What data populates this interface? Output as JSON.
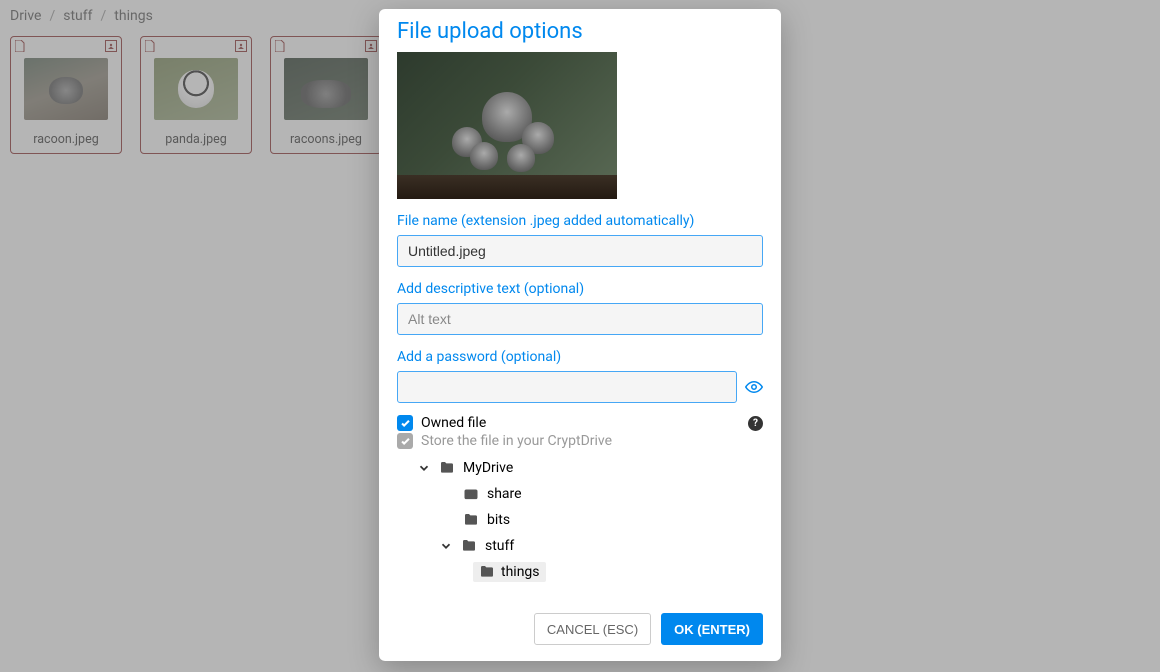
{
  "breadcrumb": [
    "Drive",
    "stuff",
    "things"
  ],
  "files": [
    {
      "name": "racoon.jpeg",
      "thumbClass": "racoon"
    },
    {
      "name": "panda.jpeg",
      "thumbClass": "panda"
    },
    {
      "name": "racoons.jpeg",
      "thumbClass": "racoons"
    }
  ],
  "modal": {
    "title": "File upload options",
    "filenameLabel": "File name (extension .jpeg added automatically)",
    "filenameValue": "Untitled.jpeg",
    "altLabel": "Add descriptive text (optional)",
    "altPlaceholder": "Alt text",
    "passwordLabel": "Add a password (optional)",
    "ownedFile": {
      "checked": true,
      "label": "Owned file"
    },
    "storeFile": {
      "checked": true,
      "label": "Store the file in your CryptDrive"
    },
    "tree": [
      {
        "depth": 1,
        "expandable": true,
        "expanded": true,
        "icon": "folder",
        "label": "MyDrive"
      },
      {
        "depth": 2,
        "expandable": false,
        "icon": "share",
        "label": "share"
      },
      {
        "depth": 2,
        "expandable": false,
        "icon": "folder",
        "label": "bits"
      },
      {
        "depth": 2,
        "expandable": true,
        "expanded": true,
        "icon": "folder",
        "label": "stuff",
        "isChevronRow": true
      },
      {
        "depth": 3,
        "expandable": false,
        "icon": "folder",
        "label": "things",
        "selected": true
      }
    ],
    "cancel": "CANCEL (ESC)",
    "ok": "OK (ENTER)"
  }
}
